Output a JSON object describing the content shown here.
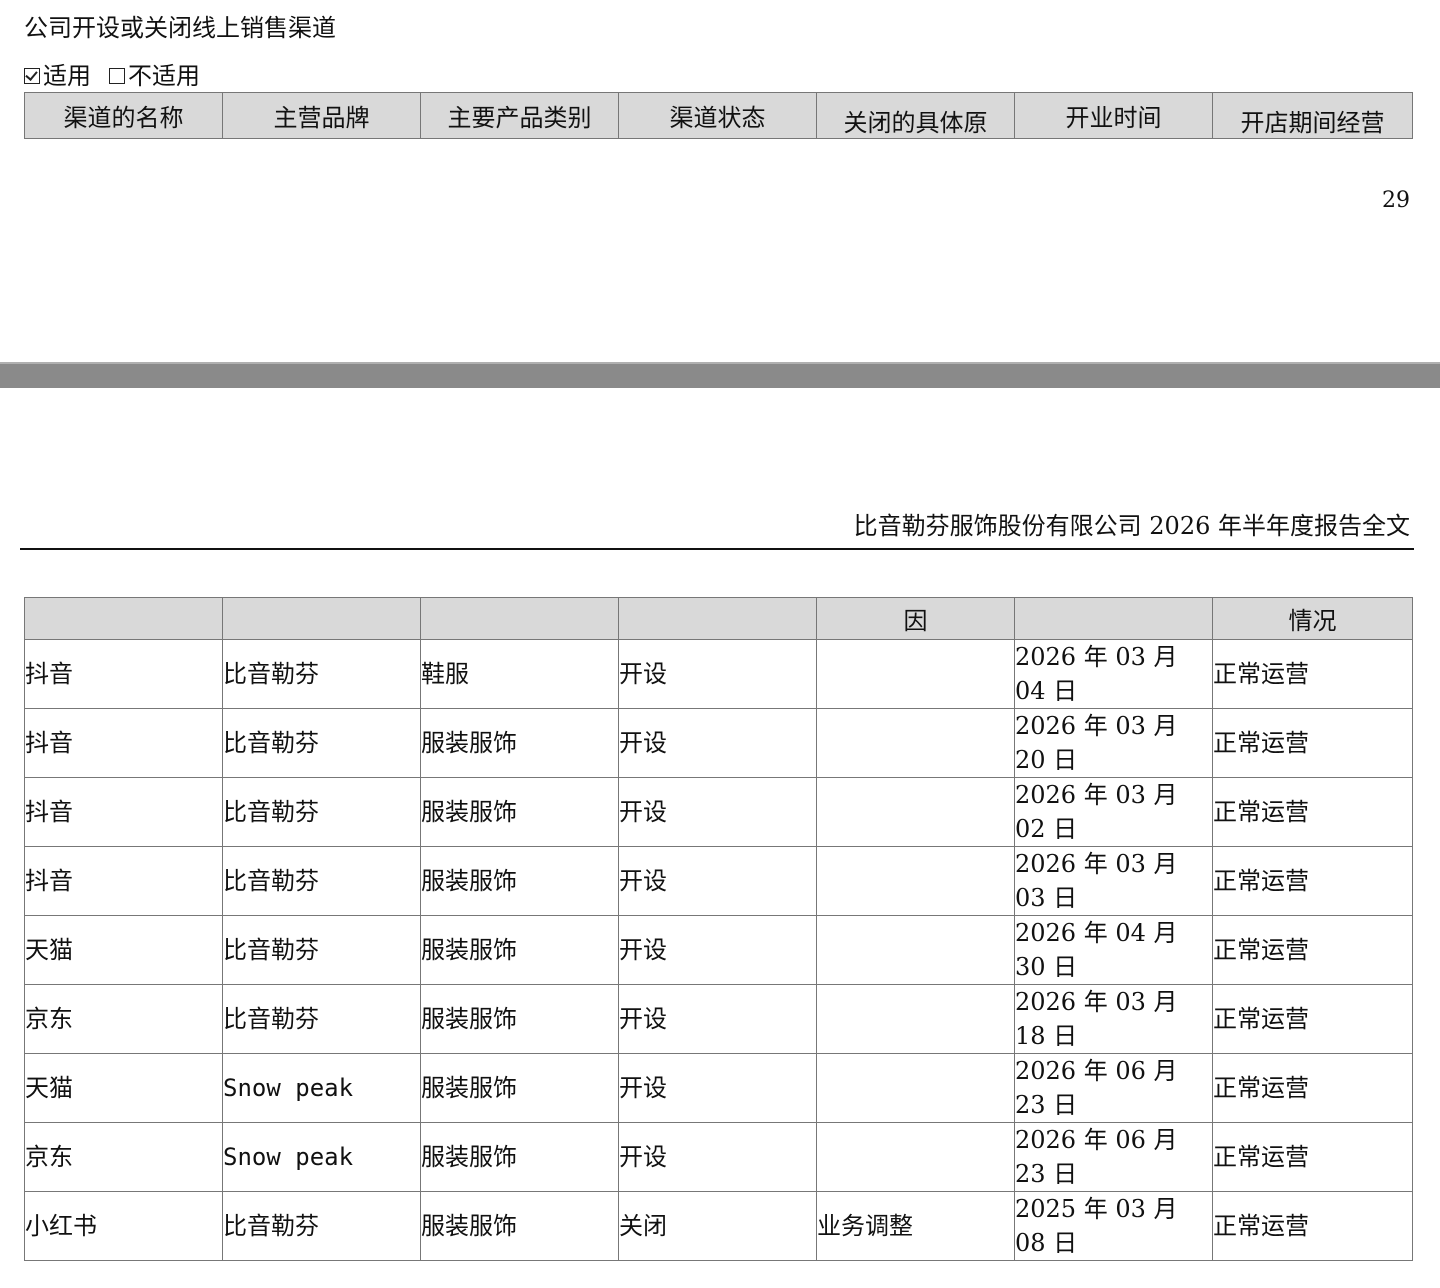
{
  "page1": {
    "section_title": "公司开设或关闭线上销售渠道",
    "applicable": {
      "checked_label": "适用",
      "unchecked_label": "不适用"
    },
    "headers": [
      "渠道的名称",
      "主营品牌",
      "主要产品类别",
      "渠道状态",
      "关闭的具体原",
      "开业时间",
      "开店期间经营"
    ],
    "page_number": "29"
  },
  "page2": {
    "running_header": "比音勒芬服饰股份有限公司 2026 年半年度报告全文",
    "header_continuation": [
      "",
      "",
      "",
      "",
      "因",
      "",
      "情况"
    ],
    "rows": [
      [
        "抖音",
        "比音勒芬",
        "鞋服",
        "开设",
        "",
        "2026 年 03 月",
        "04 日",
        "正常运营"
      ],
      [
        "抖音",
        "比音勒芬",
        "服装服饰",
        "开设",
        "",
        "2026 年 03 月",
        "20 日",
        "正常运营"
      ],
      [
        "抖音",
        "比音勒芬",
        "服装服饰",
        "开设",
        "",
        "2026 年 03 月",
        "02 日",
        "正常运营"
      ],
      [
        "抖音",
        "比音勒芬",
        "服装服饰",
        "开设",
        "",
        "2026 年 03 月",
        "03 日",
        "正常运营"
      ],
      [
        "天猫",
        "比音勒芬",
        "服装服饰",
        "开设",
        "",
        "2026 年 04 月",
        "30 日",
        "正常运营"
      ],
      [
        "京东",
        "比音勒芬",
        "服装服饰",
        "开设",
        "",
        "2026 年 03 月",
        "18 日",
        "正常运营"
      ],
      [
        "天猫",
        "Snow peak",
        "服装服饰",
        "开设",
        "",
        "2026 年 06 月",
        "23 日",
        "正常运营"
      ],
      [
        "京东",
        "Snow peak",
        "服装服饰",
        "开设",
        "",
        "2026 年 06 月",
        "23 日",
        "正常运营"
      ],
      [
        "小红书",
        "比音勒芬",
        "服装服饰",
        "关闭",
        "业务调整",
        "2025 年 03 月",
        "08 日",
        "正常运营"
      ]
    ]
  }
}
